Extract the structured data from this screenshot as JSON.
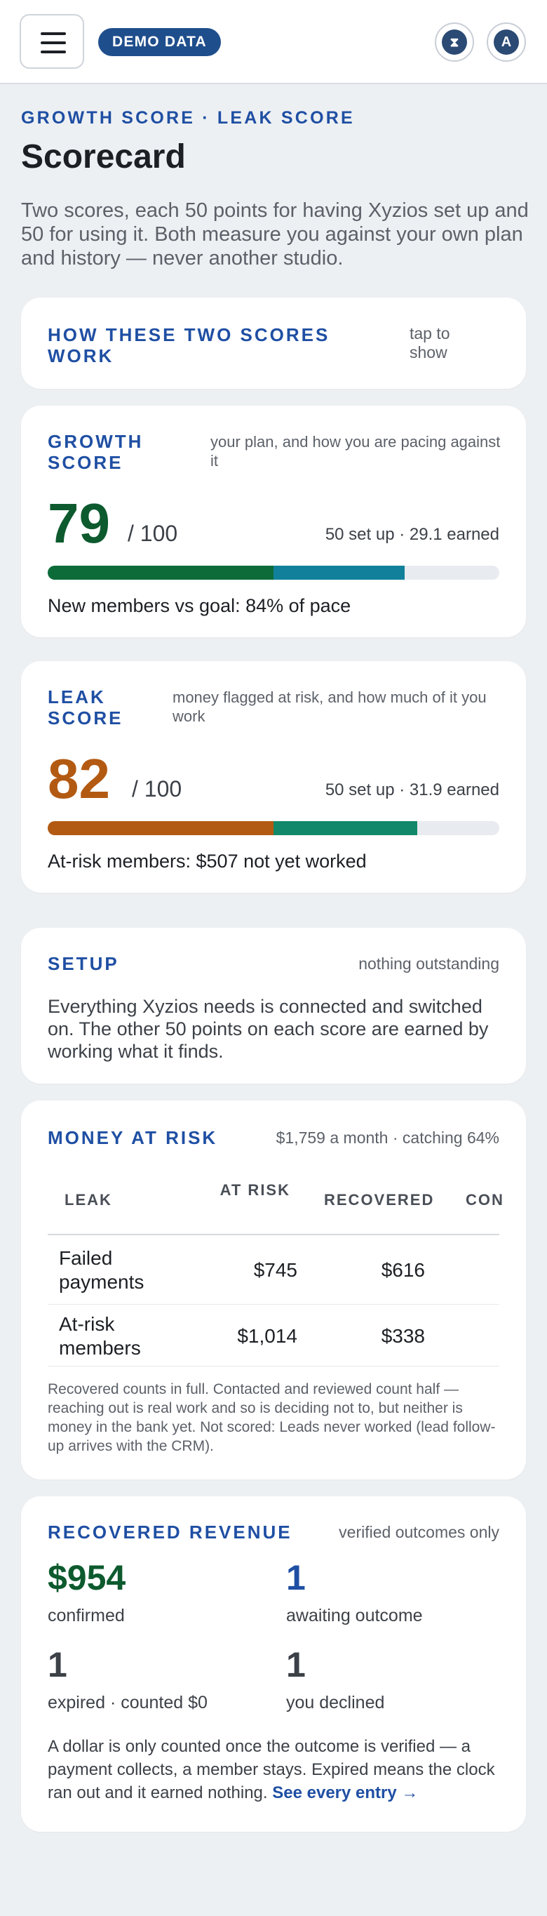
{
  "topbar": {
    "menu_label": "Menu",
    "badge": "DEMO DATA",
    "hourglass_icon": "hourglass-icon",
    "avatar_letter": "A"
  },
  "page": {
    "eyebrow": "GROWTH SCORE · LEAK SCORE",
    "title": "Scorecard",
    "intro": "Two scores, each 50 points for having Xyzios set up and 50 for using it. Both measure you against your own plan and history — never another studio."
  },
  "how": {
    "heading": "HOW THESE TWO SCORES WORK",
    "toggle": "tap to show"
  },
  "growth": {
    "heading": "GROWTH SCORE",
    "desc": "your plan, and how you are pacing against it",
    "score": "79",
    "out_of": "/ 100",
    "breakdown": "50 set up · 29.1 earned",
    "setup_points": 50,
    "earned_points": 29.1,
    "max_points": 100,
    "colors": {
      "setup": "#0d6b3a",
      "earned": "#11819b",
      "score": "#0d5a2e"
    },
    "detail": "New members vs goal: 84% of pace"
  },
  "leak": {
    "heading": "LEAK SCORE",
    "desc": "money flagged at risk, and how much of it you work",
    "score": "82",
    "out_of": "/ 100",
    "breakdown": "50 set up · 31.9 earned",
    "setup_points": 50,
    "earned_points": 31.9,
    "max_points": 100,
    "colors": {
      "setup": "#b35a12",
      "earned": "#12886a",
      "score": "#b35a12"
    },
    "detail": "At-risk members: $507 not yet worked"
  },
  "setup": {
    "heading": "SETUP",
    "status": "nothing outstanding",
    "body": "Everything Xyzios needs is connected and switched on. The other 50 points on each score are earned by working what it finds."
  },
  "money_at_risk": {
    "heading": "MONEY AT RISK",
    "summary": "$1,759 a month · catching 64%",
    "columns": [
      "LEAK",
      "AT RISK",
      "RECOVERED",
      "CON"
    ],
    "rows": [
      {
        "leak": "Failed payments",
        "at_risk": "$745",
        "recovered": "$616"
      },
      {
        "leak": "At-risk members",
        "at_risk": "$1,014",
        "recovered": "$338"
      }
    ],
    "note": "Recovered counts in full. Contacted and reviewed count half — reaching out is real work and so is deciding not to, but neither is money in the bank yet. Not scored: Leads never worked (lead follow-up arrives with the CRM)."
  },
  "recovered": {
    "heading": "RECOVERED REVENUE",
    "tag": "verified outcomes only",
    "confirmed_value": "$954",
    "confirmed_label": "confirmed",
    "awaiting_value": "1",
    "awaiting_label": "awaiting outcome",
    "expired_value": "1",
    "expired_label": "expired · counted $0",
    "declined_value": "1",
    "declined_label": "you declined",
    "body": "A dollar is only counted once the outcome is verified — a payment collects, a member stays. Expired means the clock ran out and it earned nothing.",
    "link": "See every entry →",
    "colors": {
      "confirmed": "#0d5a2e",
      "awaiting": "#1f4fa3",
      "neutral": "#3c4148"
    }
  }
}
